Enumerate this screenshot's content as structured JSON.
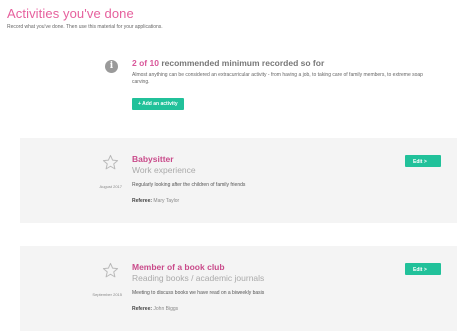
{
  "header": {
    "title": "Activities you've done",
    "subtitle": "Record what you've done. Then use this material for your applications."
  },
  "info": {
    "icon": "info-icon",
    "count_text": "2 of 10",
    "heading_rest": "recommended minimum recorded so for",
    "body": "Almost anything can be considered an extracurricular activity - from having a job, to taking care of family members, to extreme soap carving.",
    "add_button": "+ Add an activity"
  },
  "activities": [
    {
      "title": "Babysitter",
      "type": "Work experience",
      "date": "August 2017",
      "description": "Regularly looking after the children of family friends",
      "referee_label": "Referee:",
      "referee": "Mary Taylor",
      "edit_label": "Edit  >"
    },
    {
      "title": "Member of a book club",
      "type": "Reading books / academic journals",
      "date": "September 2015",
      "description": "Meeting to discuss books we have read on a biweekly basis",
      "referee_label": "Referee:",
      "referee": "John Biggs",
      "edit_label": "Edit  >"
    }
  ],
  "colors": {
    "accent_pink": "#e6609d",
    "title_pink": "#c94a8a",
    "button_green": "#21c19a",
    "card_bg": "#f4f4f4"
  }
}
